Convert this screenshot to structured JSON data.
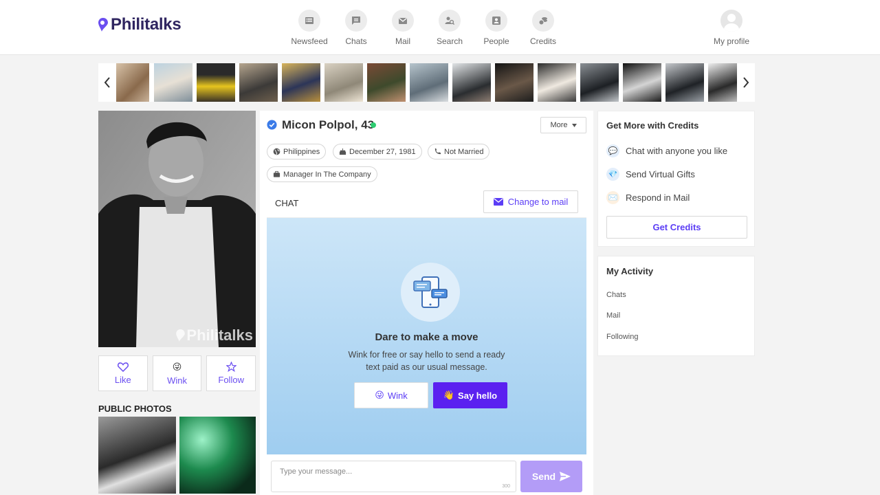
{
  "brand": {
    "name": "Philitalks",
    "accent": "#5b21f0",
    "logo_color": "#2f2560"
  },
  "nav": {
    "items": [
      {
        "label": "Newsfeed",
        "icon": "newsfeed-icon"
      },
      {
        "label": "Chats",
        "icon": "chat-icon"
      },
      {
        "label": "Mail",
        "icon": "mail-icon"
      },
      {
        "label": "Search",
        "icon": "search-icon"
      },
      {
        "label": "People",
        "icon": "people-icon"
      },
      {
        "label": "Credits",
        "icon": "credits-icon"
      }
    ],
    "profile_label": "My profile"
  },
  "profile": {
    "name_age": "Micon Polpol, 43",
    "online": true,
    "more_label": "More",
    "chips": {
      "country": "Philippines",
      "birthday": "December 27, 1981",
      "status": "Not Married",
      "job": "Manager In The Company"
    },
    "watermark": "Philitalks"
  },
  "actions": {
    "like": "Like",
    "wink": "Wink",
    "follow": "Follow"
  },
  "public_photos": {
    "title": "PUBLIC PHOTOS"
  },
  "chat": {
    "label": "CHAT",
    "change_to_mail": "Change to mail",
    "title": "Dare to make a move",
    "text": "Wink for free or say hello to send a ready text paid as our usual message.",
    "wink_button": "Wink",
    "hello_button": "Say hello",
    "input_placeholder": "Type your message...",
    "char_limit": "300",
    "send_button": "Send"
  },
  "credits_card": {
    "title": "Get More with Credits",
    "items": [
      "Chat with anyone you like",
      "Send Virtual Gifts",
      "Respond in Mail"
    ],
    "button": "Get Credits"
  },
  "activity": {
    "title": "My Activity",
    "items": [
      "Chats",
      "Mail",
      "Following"
    ]
  }
}
